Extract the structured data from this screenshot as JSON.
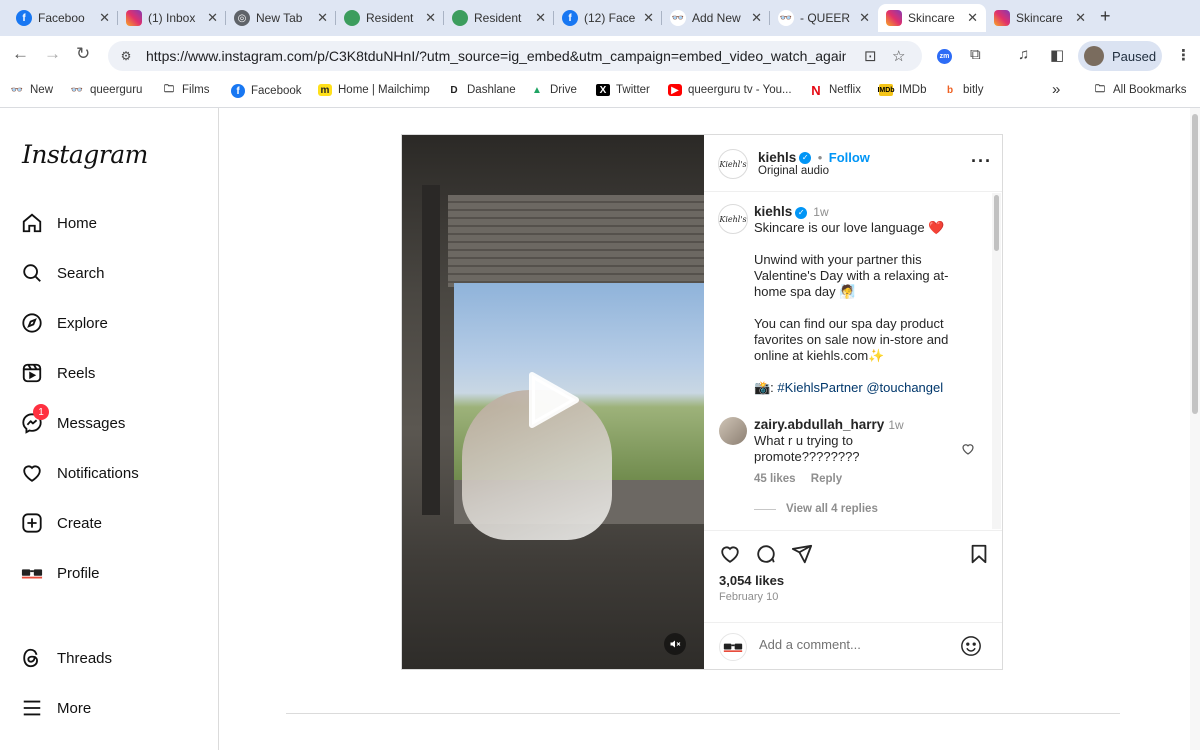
{
  "browser": {
    "tabs": [
      {
        "label": "Faceboo",
        "favicon": "facebook-icon",
        "color": "#1877f2",
        "active": false
      },
      {
        "label": "(1) Inbox",
        "favicon": "instagram-icon",
        "color": "#e1306c",
        "active": false
      },
      {
        "label": "New Tab",
        "favicon": "chrome-icon",
        "color": "#5f6368",
        "active": false
      },
      {
        "label": "Resident",
        "favicon": "globe-icon",
        "color": "#3c9d5d",
        "active": false
      },
      {
        "label": "Resident",
        "favicon": "globe-icon",
        "color": "#3c9d5d",
        "active": false
      },
      {
        "label": "(12) Face",
        "favicon": "facebook-icon",
        "color": "#1877f2",
        "active": false
      },
      {
        "label": "Add New",
        "favicon": "glasses-icon",
        "color": "#444444",
        "active": false
      },
      {
        "label": "- QUEER",
        "favicon": "glasses-icon",
        "color": "#444444",
        "active": false
      },
      {
        "label": "Skincare",
        "favicon": "instagram-icon",
        "color": "#e1306c",
        "active": true
      },
      {
        "label": "Skincare",
        "favicon": "instagram-icon",
        "color": "#e1306c",
        "active": false
      }
    ],
    "url": "https://www.instagram.com/p/C3K8tduNHnI/?utm_source=ig_embed&utm_campaign=embed_video_watch_again",
    "profile_status": "Paused",
    "extension_badge": "zm",
    "bookmarks": [
      {
        "label": "New",
        "icon": "glasses-icon"
      },
      {
        "label": "queerguru",
        "icon": "glasses-icon"
      },
      {
        "label": "Films",
        "icon": "folder-icon"
      },
      {
        "label": "Facebook",
        "icon": "facebook-icon"
      },
      {
        "label": "Home | Mailchimp",
        "icon": "mailchimp-icon"
      },
      {
        "label": "Dashlane",
        "icon": "dashlane-icon"
      },
      {
        "label": "Drive",
        "icon": "drive-icon"
      },
      {
        "label": "Twitter",
        "icon": "x-icon"
      },
      {
        "label": "queerguru tv - You...",
        "icon": "youtube-icon"
      },
      {
        "label": "Netflix",
        "icon": "netflix-icon"
      },
      {
        "label": "IMDb",
        "icon": "imdb-icon"
      },
      {
        "label": "bitly",
        "icon": "bitly-icon"
      }
    ],
    "bookmarks_more": "»",
    "all_bookmarks": "All Bookmarks"
  },
  "sidebar": {
    "logo": "Instagram",
    "items": [
      {
        "label": "Home",
        "icon": "home-icon"
      },
      {
        "label": "Search",
        "icon": "search-icon"
      },
      {
        "label": "Explore",
        "icon": "compass-icon"
      },
      {
        "label": "Reels",
        "icon": "reels-icon"
      },
      {
        "label": "Messages",
        "icon": "messenger-icon",
        "badge": "1"
      },
      {
        "label": "Notifications",
        "icon": "heart-icon"
      },
      {
        "label": "Create",
        "icon": "plus-square-icon"
      },
      {
        "label": "Profile",
        "icon": "glasses-icon"
      },
      {
        "label": "Threads",
        "icon": "threads-icon"
      },
      {
        "label": "More",
        "icon": "menu-icon"
      }
    ]
  },
  "post": {
    "author": "kiehls",
    "avatar_text": "Kiehl's",
    "follow": "Follow",
    "audio": "Original audio",
    "caption": {
      "username": "kiehls",
      "time": "1w",
      "line1": "Skincare is our love language ❤️",
      "para2": "Unwind with your partner this Valentine's Day with a relaxing at-home spa day 🧖",
      "para3": "You can find our spa day product favorites on sale now in-store and online at kiehls.com✨",
      "para4_prefix": "📸: ",
      "hashtag": "#KiehlsPartner",
      "mention": "@touchangel"
    },
    "comment": {
      "username": "zairy.abdullah_harry",
      "time": "1w",
      "text": "What r u trying to promote????????",
      "likes": "45 likes",
      "reply": "Reply",
      "view_replies": "View all 4 replies"
    },
    "likes": "3,054 likes",
    "date": "February 10",
    "add_comment_placeholder": "Add a comment..."
  },
  "colors": {
    "accent": "#0095f6",
    "badge": "#ff3040",
    "link": "#00376b"
  }
}
